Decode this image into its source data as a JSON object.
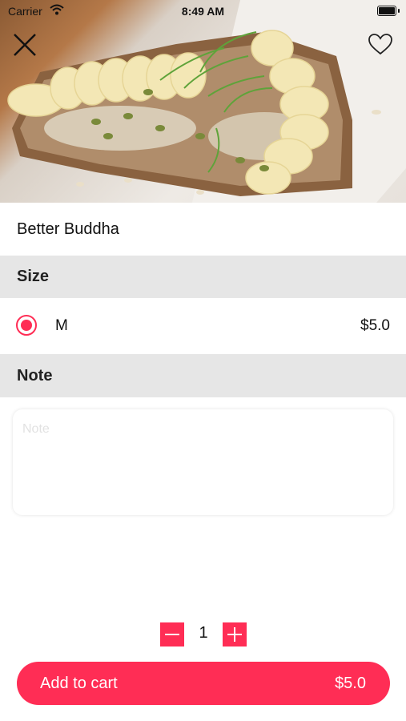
{
  "status_bar": {
    "carrier": "Carrier",
    "time": "8:49 AM"
  },
  "product": {
    "name": "Better Buddha",
    "image": "avocado toast with banana slices, seeds and microgreens"
  },
  "size_section": {
    "title": "Size",
    "options": [
      {
        "label": "M",
        "price": "$5.0",
        "selected": true
      }
    ]
  },
  "note_section": {
    "title": "Note",
    "placeholder": "Note"
  },
  "quantity": {
    "value": "1"
  },
  "cart_button": {
    "label": "Add to cart",
    "price": "$5.0"
  },
  "colors": {
    "accent": "#ff2d55",
    "section_bg": "#e6e6e6",
    "text": "#111111"
  },
  "icons": [
    "wifi-icon",
    "battery-icon",
    "close-icon",
    "heart-icon",
    "minus-icon",
    "plus-icon"
  ]
}
